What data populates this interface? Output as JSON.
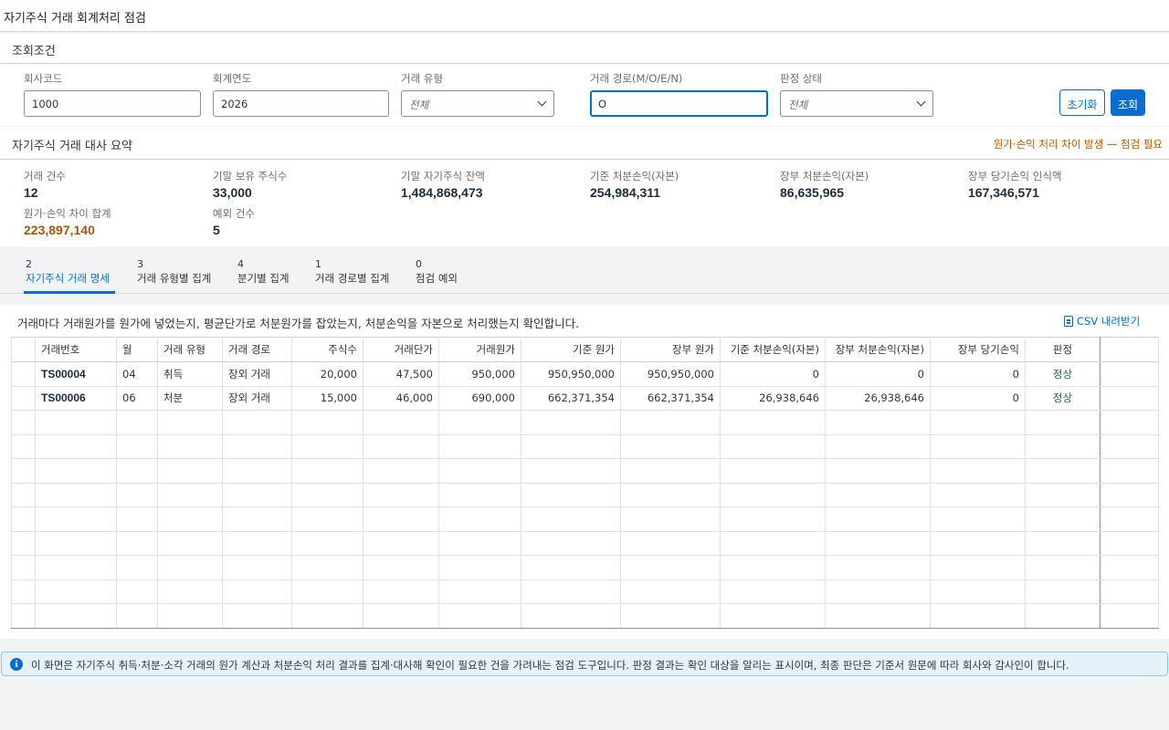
{
  "app": {
    "title": "자기주식 거래 회계처리 점검"
  },
  "conditions": {
    "title": "조회조건",
    "fields": {
      "company_code": {
        "label": "회사코드",
        "value": "1000"
      },
      "fiscal_year": {
        "label": "회계연도",
        "value": "2026"
      },
      "trade_type": {
        "label": "거래 유형",
        "value": "전체"
      },
      "trade_route": {
        "label": "거래 경로(M/O/E/N)",
        "value": "O"
      },
      "judgment_status": {
        "label": "판정 상태",
        "value": "전체"
      }
    },
    "reset_label": "초기화",
    "search_label": "조회"
  },
  "summary": {
    "title": "자기주식 거래 대사 요약",
    "warning": "원가·손익 처리 차이 발생 — 점검 필요",
    "kpis": [
      {
        "label": "거래 건수",
        "value": "12"
      },
      {
        "label": "기말 보유 주식수",
        "value": "33,000"
      },
      {
        "label": "기말 자기주식 잔액",
        "value": "1,484,868,473"
      },
      {
        "label": "기준 처분손익(자본)",
        "value": "254,984,311"
      },
      {
        "label": "장부 처분손익(자본)",
        "value": "86,635,965"
      },
      {
        "label": "장부 당기손익 인식액",
        "value": "167,346,571"
      },
      {
        "label": "원가·손익 차이 합계",
        "value": "223,897,140"
      },
      {
        "label": "예외 건수",
        "value": "5"
      }
    ]
  },
  "tabs": [
    {
      "count": "2",
      "label": "자기주식 거래 명세"
    },
    {
      "count": "3",
      "label": "거래 유형별 집계"
    },
    {
      "count": "4",
      "label": "분기별 집계"
    },
    {
      "count": "1",
      "label": "거래 경로별 집계"
    },
    {
      "count": "0",
      "label": "점검 예외"
    }
  ],
  "table": {
    "description": "거래마다 거래원가를 원가에 넣었는지, 평균단가로 처분원가를 잡았는지, 처분손익을 자본으로 처리했는지 확인합니다.",
    "csv_label": "CSV 내려받기",
    "columns": [
      "거래번호",
      "월",
      "거래 유형",
      "거래 경로",
      "주식수",
      "거래단가",
      "거래원가",
      "기준 원가",
      "장부 원가",
      "기준 처분손익(자본)",
      "장부 처분손익(자본)",
      "장부 당기손익",
      "판정"
    ],
    "rows": [
      [
        "TS00004",
        "04",
        "취득",
        "장외 거래",
        "20,000",
        "47,500",
        "950,000",
        "950,950,000",
        "950,950,000",
        "0",
        "0",
        "0",
        "정상"
      ],
      [
        "TS00006",
        "06",
        "처분",
        "장외 거래",
        "15,000",
        "46,000",
        "690,000",
        "662,371,354",
        "662,371,354",
        "26,938,646",
        "26,938,646",
        "0",
        "정상"
      ]
    ]
  },
  "info": {
    "message": "이 화면은 자기주식 취득·처분·소각 거래의 원가 계산과 처분손익 처리 결과를 집계·대사해 확인이 필요한 건을 가려내는 점검 도구입니다. 판정 결과는 확인 대상을 알리는 표시이며, 최종 판단은 기준서 원문에 따라 회사와 감사인이 합니다."
  },
  "colors": {
    "accent": "#0a6ed1",
    "warning": "#c35500",
    "ok": "#256f3a",
    "kpi_highlight": "#a9560a"
  }
}
